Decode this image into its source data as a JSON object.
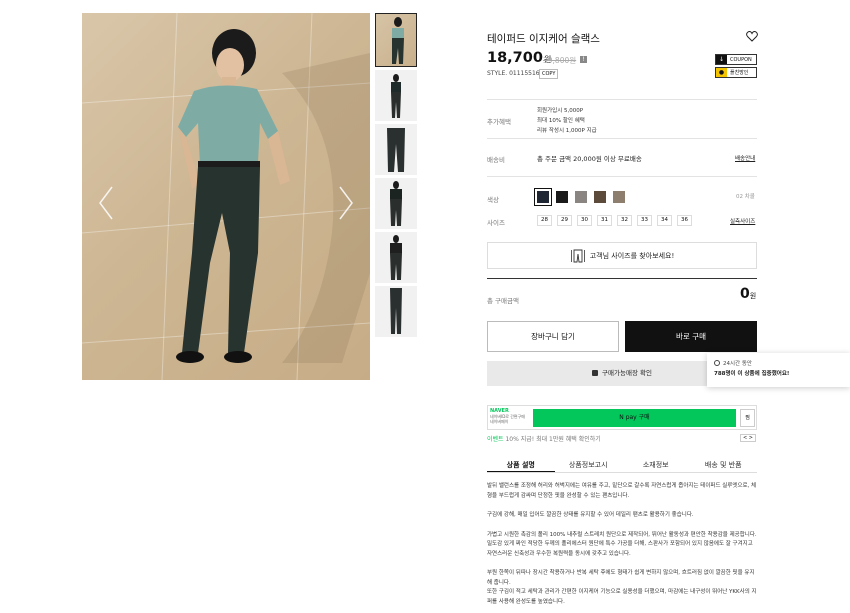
{
  "product": {
    "title": "테이퍼드 이지케어 슬랙스",
    "price": "18,700",
    "price_unit": "원",
    "original_price": "39,800원",
    "style_code": "STYLE. 01115516",
    "copy_label": "COPY",
    "coupon_label": "COUPON",
    "visit_label": "플친방인"
  },
  "benefits": {
    "label": "추가혜택",
    "lines": [
      "회원가입시 5,000P",
      "최대 10% 할인 혜택",
      "리뷰 작성시 1,000P 지급"
    ]
  },
  "shipping": {
    "label": "배송비",
    "text": "총 주문 금액 20,000원 이상 무료배송",
    "link": "배송안내"
  },
  "colors": {
    "label": "색상",
    "count": "02 차콜",
    "swatches": [
      "#1e2733",
      "#1a1a1a",
      "#8a8580",
      "#5c4a3a",
      "#8e7e6e"
    ]
  },
  "sizes": {
    "label": "사이즈",
    "options": [
      "28",
      "29",
      "30",
      "31",
      "32",
      "33",
      "34",
      "36"
    ],
    "link": "실측사이즈"
  },
  "size_finder": {
    "label": "고객님 사이즈를 찾아보세요!"
  },
  "total": {
    "label": "총 구매금액",
    "value": "0",
    "unit": "원"
  },
  "actions": {
    "cart": "장바구니 담기",
    "buy": "바로 구매",
    "store": "구매가능매장 확인"
  },
  "popup": {
    "line1": "24시간 동안",
    "line2": "788명이 이 상품에 집중했어요!"
  },
  "naver": {
    "brand": "NAVER",
    "sub1": "네이버ID로 간편구매",
    "sub2": "네이버페이",
    "pay": "N pay 구매",
    "zzim": "찜"
  },
  "event": {
    "tag": "이벤트",
    "text": "10% 지급! 최대 1만원 혜택 확인하기",
    "nav": "< >"
  },
  "tabs": [
    "상품 설명",
    "상품정보고시",
    "소재정보",
    "배송 및 반품"
  ],
  "description": [
    "발뒤 밸런스를 조정해 허리와 허벅지에는 여유를 주고, 밑단으로 갈수록 자연스럽게 좁아지는 테이퍼드 실루엣으로, 체형을 부드럽게 감싸며 단정한 핏을 완성할 수 있는 팬츠입니다.",
    "구김에 강해, 매일 입어도 깔끔한 상태를 유지할 수 있어 데일리 팬츠로 활용하기 좋습니다.",
    "가볍고 시원한 촉감의 폴리 100% 내추럴 스트레치 원단으로 제작되어, 뛰어난 활동성과 편안한 착용감을 제공합니다. 밀도감 있게 짜인 적당한 두께의 폴리에스터 원단에 특수 가공을 더해, 스판사가 포함되어 있지 않음에도 잘 구겨지고 자연스러운 신축성과 우수한 복원력을 동시에 갖추고 있습니다.",
    "부원 한쪽이 뒤따나 장시간 착용하거나 반복 세탁 후에도 형태가 쉽게 변하지 않으며, 흐트러짐 없이 깔끔한 핏을 유지해 줍니다.\n또한 구김이 적고 세탁과 관리가 간편한 이지케어 기능으로 실용성을 더했으며, 마감에는 내구성이 뛰어난 YKK사의 지퍼를 사용해 완성도를 높였습니다."
  ]
}
